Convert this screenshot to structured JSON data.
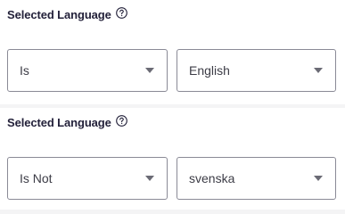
{
  "filters": [
    {
      "label": "Selected Language",
      "help_icon": "question-circle-icon",
      "operator": {
        "value": "Is",
        "icon": "caret-down-icon"
      },
      "value": {
        "value": "English",
        "icon": "caret-down-icon"
      }
    },
    {
      "label": "Selected Language",
      "help_icon": "question-circle-icon",
      "operator": {
        "value": "Is Not",
        "icon": "caret-down-icon"
      },
      "value": {
        "value": "svenska",
        "icon": "caret-down-icon"
      }
    }
  ],
  "colors": {
    "label": "#23213a",
    "border": "#8a8a96",
    "caret": "#6b6b75",
    "divider": "#f4f4f5"
  }
}
